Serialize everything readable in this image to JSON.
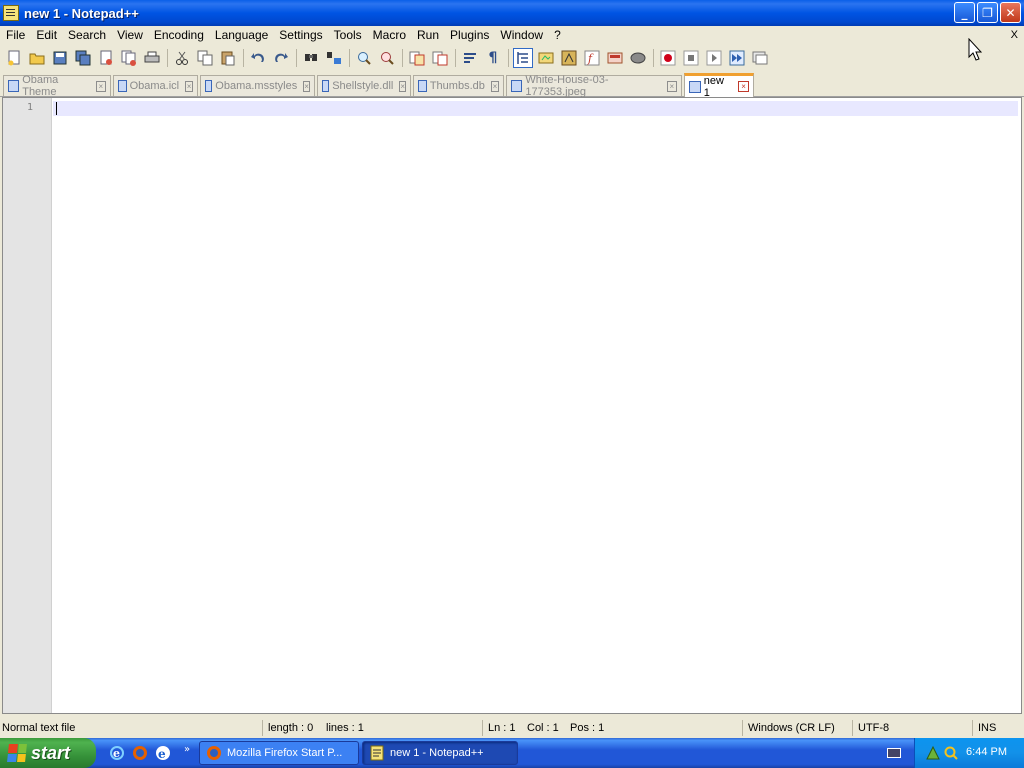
{
  "window": {
    "title": "new 1 - Notepad++",
    "buttons": {
      "minimize": "_",
      "maximize": "❐",
      "close": "✕"
    }
  },
  "menu": {
    "items": [
      "File",
      "Edit",
      "Search",
      "View",
      "Encoding",
      "Language",
      "Settings",
      "Tools",
      "Macro",
      "Run",
      "Plugins",
      "Window",
      "?"
    ],
    "close": "X"
  },
  "toolbar": {
    "icons": [
      "new-file-icon",
      "open-file-icon",
      "save-icon",
      "save-all-icon",
      "close-icon",
      "close-all-icon",
      "print-icon",
      "cut-icon",
      "copy-icon",
      "paste-icon",
      "undo-icon",
      "redo-icon",
      "find-icon",
      "replace-icon",
      "zoom-in-icon",
      "zoom-out-icon",
      "sync-vertical-icon",
      "sync-horizontal-icon",
      "word-wrap-icon",
      "show-all-chars-icon",
      "indent-guide-icon",
      "user-lang-icon",
      "doc-map-icon",
      "function-list-icon",
      "folder-workspace-icon",
      "monitor-icon",
      "record-macro-icon",
      "stop-macro-icon",
      "play-macro-icon",
      "run-macro-multiple-icon",
      "save-macro-icon"
    ]
  },
  "tabs": [
    {
      "label": "Obama Theme",
      "active": false
    },
    {
      "label": "Obama.icl",
      "active": false
    },
    {
      "label": "Obama.msstyles",
      "active": false
    },
    {
      "label": "Shellstyle.dll",
      "active": false
    },
    {
      "label": "Thumbs.db",
      "active": false
    },
    {
      "label": "White-House-03-177353.jpeg",
      "active": false
    },
    {
      "label": "new 1",
      "active": true
    }
  ],
  "editor": {
    "line_numbers": [
      "1"
    ],
    "content": ""
  },
  "status": {
    "file_type": "Normal text file",
    "length": "length : 0",
    "lines": "lines : 1",
    "ln": "Ln : 1",
    "col": "Col : 1",
    "pos": "Pos : 1",
    "eol": "Windows (CR LF)",
    "encoding": "UTF-8",
    "mode": "INS"
  },
  "taskbar": {
    "start": "start",
    "quicklaunch_more": "»",
    "tasks": [
      {
        "label": "Mozilla Firefox Start P...",
        "active": false
      },
      {
        "label": "new 1 - Notepad++",
        "active": true
      }
    ],
    "clock": "6:44 PM"
  },
  "colors": {
    "titlebar": "#0054e3",
    "active_tab_accent": "#f0a030",
    "current_line": "#e8e8ff",
    "start_button": "#36923a",
    "taskbar": "#2157d7"
  }
}
